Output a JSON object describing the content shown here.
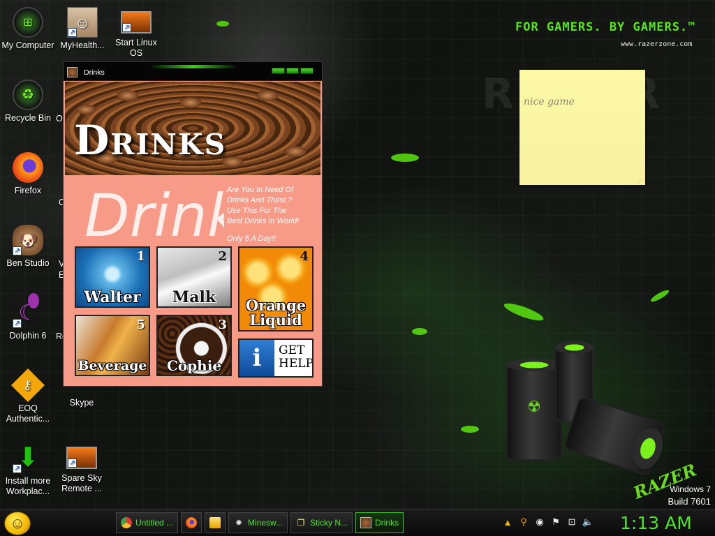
{
  "wallpaper": {
    "slogan": "FOR GAMERS. BY GAMERS.™",
    "url": "www.razerzone.com",
    "logo": "RAZER",
    "os_name": "Windows 7",
    "build": "Build 7601",
    "accent_color": "#5be30f"
  },
  "desktop_icons": [
    {
      "label": "My Computer",
      "icon": "computer-icon"
    },
    {
      "label": "MyHealth...",
      "icon": "avatar-icon"
    },
    {
      "label": "Start Linux OS",
      "icon": "monitor-icon"
    },
    {
      "label": "Recycle Bin",
      "icon": "recycle-bin-icon"
    },
    {
      "label": "Firefox",
      "icon": "firefox-icon"
    },
    {
      "label": "Ben Studio",
      "icon": "dog-icon"
    },
    {
      "label": "Dolphin 6",
      "icon": "dolphin-icon"
    },
    {
      "label": "EOQ Authentic...",
      "icon": "key-icon"
    },
    {
      "label": "Skype",
      "icon": "skype-icon"
    },
    {
      "label": "Install more Workplac...",
      "icon": "download-arrow-icon"
    },
    {
      "label": "Spare Sky Remote ...",
      "icon": "monitor-icon"
    }
  ],
  "partial_labels": [
    "O",
    "C",
    "V",
    "E",
    "Re"
  ],
  "sticky_note": {
    "text": "nice game"
  },
  "drinks_window": {
    "title": "Drinks",
    "banner_title": "Drinks",
    "ghost_title": "Drink",
    "promo_lines": [
      "Are You In Need Of",
      "Drinks And Thirst.?",
      "Use This For The",
      "Best Drinks In World!"
    ],
    "price": "Only 5 A Day!!",
    "tiles": [
      {
        "number": "1",
        "label": "Walter"
      },
      {
        "number": "2",
        "label": "Malk"
      },
      {
        "number": "4",
        "label": "Orange Liquid"
      },
      {
        "number": "5",
        "label": "Beverage"
      },
      {
        "number": "3",
        "label": "Cophie"
      }
    ],
    "help": {
      "line1": "GET",
      "line2": "HELP"
    },
    "bg_color": "#f79b88"
  },
  "taskbar": {
    "tasks": [
      {
        "label": "Untitled ...",
        "icon": "chrome-icon"
      },
      {
        "label": "",
        "icon": "firefox-icon"
      },
      {
        "label": "",
        "icon": "folder-icon"
      },
      {
        "label": "Minesw...",
        "icon": "mine-icon"
      },
      {
        "label": "Sticky N...",
        "icon": "sticky-note-icon"
      },
      {
        "label": "Drinks",
        "icon": "coffee-icon"
      }
    ],
    "clock": "1:13 AM",
    "text_color": "#4ee52c"
  }
}
